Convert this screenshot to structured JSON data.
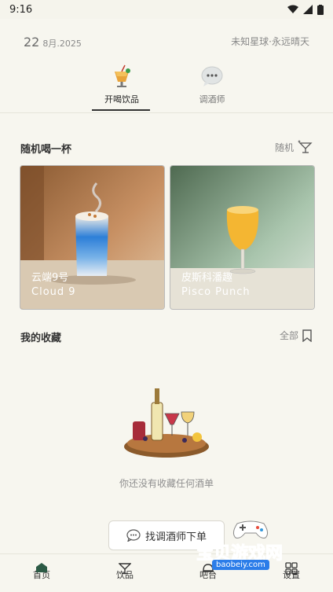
{
  "status": {
    "time": "9:16"
  },
  "header": {
    "day": "22",
    "month": "8月.2025",
    "weather": "未知星球·永远晴天"
  },
  "tabs": [
    {
      "label": "开喝饮品",
      "active": true
    },
    {
      "label": "调酒师",
      "active": false
    }
  ],
  "random": {
    "title": "随机喝一杯",
    "action": "随机",
    "cards": [
      {
        "name_zh": "云端9号",
        "name_en": "Cloud 9"
      },
      {
        "name_zh": "皮斯科潘趣",
        "name_en": "Pisco Punch"
      }
    ]
  },
  "favorites": {
    "title": "我的收藏",
    "action": "全部",
    "empty_text": "你还没有收藏任何酒单"
  },
  "order_button": {
    "label": "找调酒师下单"
  },
  "bottom_nav": [
    {
      "label": "首页"
    },
    {
      "label": "饮品"
    },
    {
      "label": "吧台"
    },
    {
      "label": "设置"
    }
  ],
  "watermark": {
    "text": "宝贝游戏网",
    "url": "baobeiy.com"
  },
  "colors": {
    "background": "#f7f6ef",
    "accent": "#333333"
  }
}
